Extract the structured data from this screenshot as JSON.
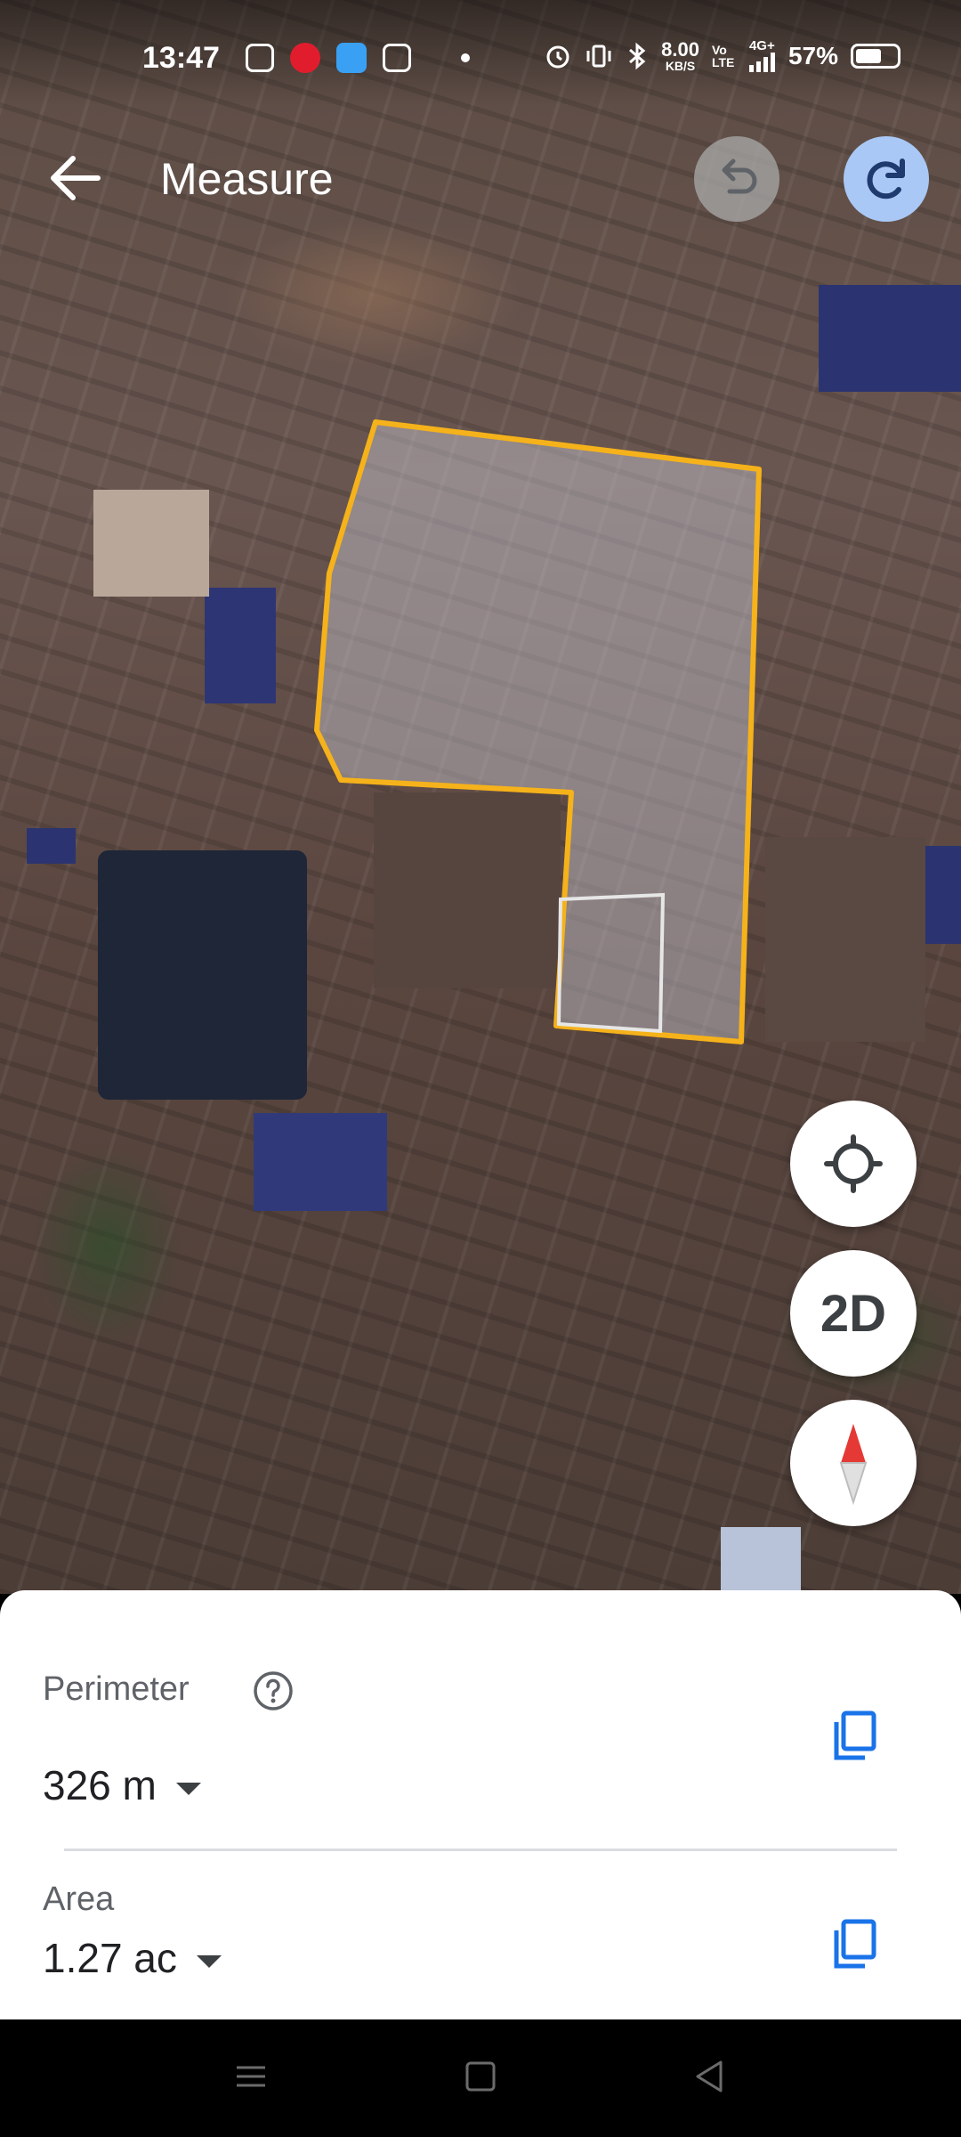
{
  "status_bar": {
    "time": "13:47",
    "net_speed": "8.00",
    "net_unit": "KB/S",
    "volte": "Vo LTE",
    "network": "4G+",
    "battery": "57%",
    "icons": [
      "instagram-icon",
      "jio-icon",
      "app-icon",
      "calculator-icon",
      "dot-icon",
      "alarm-icon",
      "vibrate-icon",
      "bluetooth-icon",
      "signal-icon",
      "battery-icon"
    ]
  },
  "header": {
    "title": "Measure",
    "back_icon": "arrow-back-icon",
    "undo_icon": "undo-icon",
    "redo_icon": "redo-icon"
  },
  "map_controls": {
    "location_icon": "my-location-icon",
    "view_toggle_label": "2D",
    "compass_icon": "compass-icon"
  },
  "measurement": {
    "outline_color": "#f5b21a",
    "perimeter": {
      "label": "Perimeter",
      "value": "326 m"
    },
    "area": {
      "label": "Area",
      "value": "1.27 ac"
    }
  },
  "colors": {
    "accent_blue": "#1a73e8",
    "redo_bg": "#a9c8f5"
  }
}
